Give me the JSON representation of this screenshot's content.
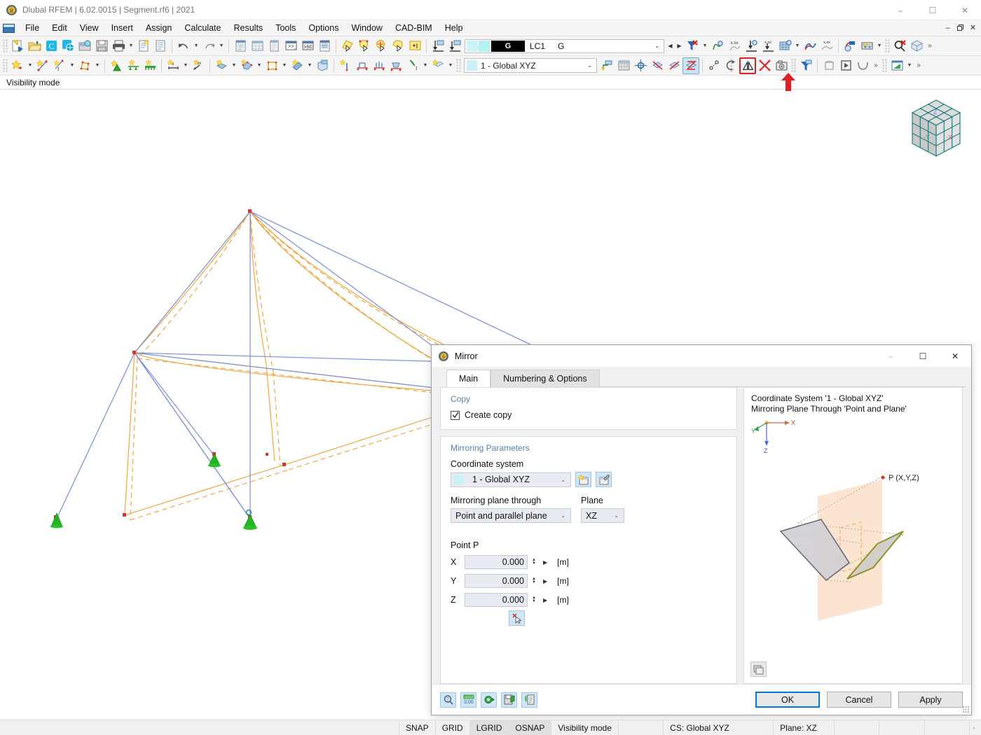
{
  "window": {
    "title": "Dlubal RFEM | 6.02.0015 | Segment.rf6 | 2021",
    "app_icon": "rfem-logo-icon",
    "minimize": "–",
    "maximize": "☐",
    "close": "✕"
  },
  "mdi": {
    "minimize": "–",
    "restore": "❐",
    "close": "✕"
  },
  "menu": {
    "items": [
      {
        "label": "File"
      },
      {
        "label": "Edit"
      },
      {
        "label": "View"
      },
      {
        "label": "Insert"
      },
      {
        "label": "Assign"
      },
      {
        "label": "Calculate"
      },
      {
        "label": "Results"
      },
      {
        "label": "Tools"
      },
      {
        "label": "Options"
      },
      {
        "label": "Window"
      },
      {
        "label": "CAD-BIM"
      },
      {
        "label": "Help"
      }
    ]
  },
  "toolbar_main": {
    "load_case": {
      "selected_code": "G",
      "code_label": "LC1",
      "name": "G",
      "arrow": "⌄"
    },
    "icons": [
      "new-model-icon",
      "open-folder-icon",
      "dlubal-center-icon",
      "dlubal-web-icon",
      "project-manager-icon",
      "save-icon",
      "print-icon",
      "new-report-icon",
      "printout-report-icon",
      "undo-icon",
      "redo-icon",
      "navigator-icon",
      "table-icon",
      "list-table-icon",
      "console-icon",
      "script-icon",
      "model-data-icon",
      "select-objects-icon",
      "select-by-circle-icon",
      "select-special-icon",
      "select-lasso-icon",
      "select-plus-icon",
      "load-import-icon",
      "load-export-icon",
      "filter-delete-icon",
      "results-values-icon",
      "numeric-results-icon",
      "deformation-icon",
      "deformation-values-icon",
      "grid-results-icon",
      "diagram-icon",
      "diagram-values-icon",
      "result-diagram-icon",
      "abacus-icon",
      "zoom-delete-icon",
      "render-cube-icon"
    ]
  },
  "toolbar_model": {
    "coordinate_system": {
      "value": "1 - Global XYZ",
      "arrow": "⌄"
    },
    "mirror_tool": "mirror-tool-icon",
    "highlighted_tool": "mirror-tool-icon",
    "icons": [
      "new-node-icon",
      "new-line-icon",
      "new-line-arc-icon",
      "new-polyline-icon",
      "new-support-icon",
      "new-line-support-icon",
      "new-member-support-icon",
      "dimension-x-icon",
      "dimension-xx-icon",
      "new-surface-icon",
      "new-solid-icon",
      "new-opening-icon",
      "new-member-icon",
      "new-section-icon",
      "member-hinge-icon",
      "nodal-release-icon",
      "line-release-icon",
      "surface-release-icon",
      "load-case-icon",
      "load-combo-icon",
      "cs-origin-icon",
      "grid-icon",
      "snap-grid-icon",
      "plane-x-icon",
      "plane-y-icon",
      "plane-z-icon",
      "move-icon",
      "rotate-icon",
      "mirror-tool-icon",
      "delete-x-icon",
      "camera-icon",
      "filter-icon",
      "extrude-icon",
      "animation-icon",
      "curve-icon",
      "more-icon",
      "diagram-green-icon"
    ]
  },
  "viewport": {
    "mode_label": "Visibility mode",
    "nav_cube": {
      "axis_labels": [
        "-X",
        "-Y",
        "Z"
      ]
    }
  },
  "dialog": {
    "title": "Mirror",
    "icon": "mirror-dialog-icon",
    "minimize": "–",
    "maximize": "☐",
    "close": "✕",
    "tabs": [
      {
        "label": "Main",
        "selected": true
      },
      {
        "label": "Numbering & Options",
        "selected": false
      }
    ],
    "copy_group": {
      "heading": "Copy",
      "create_copy_label": "Create copy",
      "create_copy_checked": true
    },
    "mirroring_group": {
      "heading": "Mirroring Parameters",
      "coordinate_system_label": "Coordinate system",
      "coordinate_system_value": "1 - Global XYZ",
      "new_cs_icon": "new-coordinate-system-icon",
      "edit_cs_icon": "edit-coordinate-system-icon",
      "plane_through_label": "Mirroring plane through",
      "plane_through_value": "Point and parallel plane",
      "plane_label": "Plane",
      "plane_value": "XZ",
      "point_label": "Point P",
      "pick_point_icon": "pick-point-cursor-icon",
      "coords": [
        {
          "axis": "X",
          "value": "0.000",
          "unit": "[m]"
        },
        {
          "axis": "Y",
          "value": "0.000",
          "unit": "[m]"
        },
        {
          "axis": "Z",
          "value": "0.000",
          "unit": "[m]"
        }
      ]
    },
    "preview": {
      "line1": "Coordinate System '1 - Global XYZ'",
      "line2": "Mirroring Plane Through 'Point and Plane'",
      "point_label": "P (X,Y,Z)",
      "axes": {
        "x": "X",
        "y": "Y",
        "z": "Z"
      },
      "snapshot_icon": "snapshot-icon"
    },
    "footer": {
      "tool_icons": [
        "help-search-icon",
        "units-icon",
        "settings-green-icon",
        "save-defaults-icon",
        "copy-list-icon"
      ],
      "ok": "OK",
      "cancel": "Cancel",
      "apply": "Apply"
    }
  },
  "statusbar": {
    "snap": "SNAP",
    "grid": "GRID",
    "lgrid": "LGRID",
    "osnap": "OSNAP",
    "mode": "Visibility mode",
    "cs": "CS: Global XYZ",
    "plane": "Plane: XZ"
  },
  "colors": {
    "member_blue": "#7a8fd8",
    "member_orange": "#f0a030",
    "support_green": "#22b522",
    "node_red": "#e03030",
    "accent_blue": "#0078d7",
    "highlight_red": "#e02020",
    "group_heading": "#5a7fa8"
  }
}
